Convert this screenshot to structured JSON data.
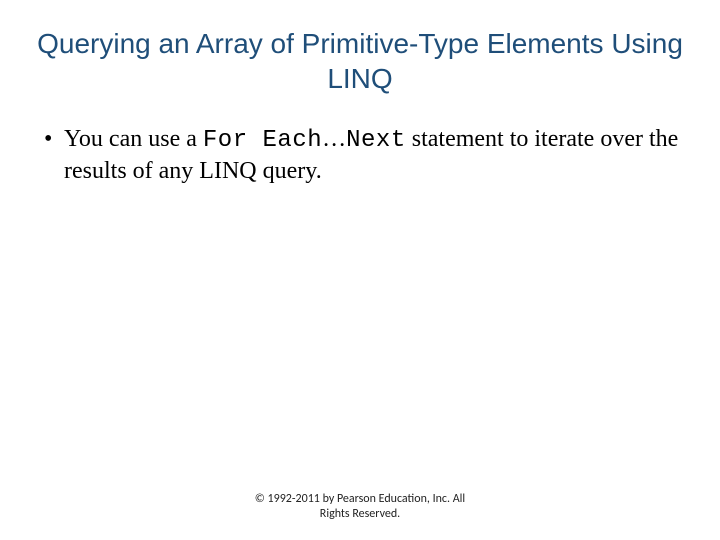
{
  "title": "Querying an Array of Primitive-Type Elements Using LINQ",
  "bullet": {
    "pre": "You can use a ",
    "code1": "For",
    "sp1": " ",
    "code2": "Each",
    "ellipsis": "…",
    "code3": "Next",
    "post": " statement to iterate over the results of any LINQ query."
  },
  "footer": {
    "line1": "© 1992-2011 by Pearson Education, Inc. All",
    "line2": "Rights Reserved."
  }
}
